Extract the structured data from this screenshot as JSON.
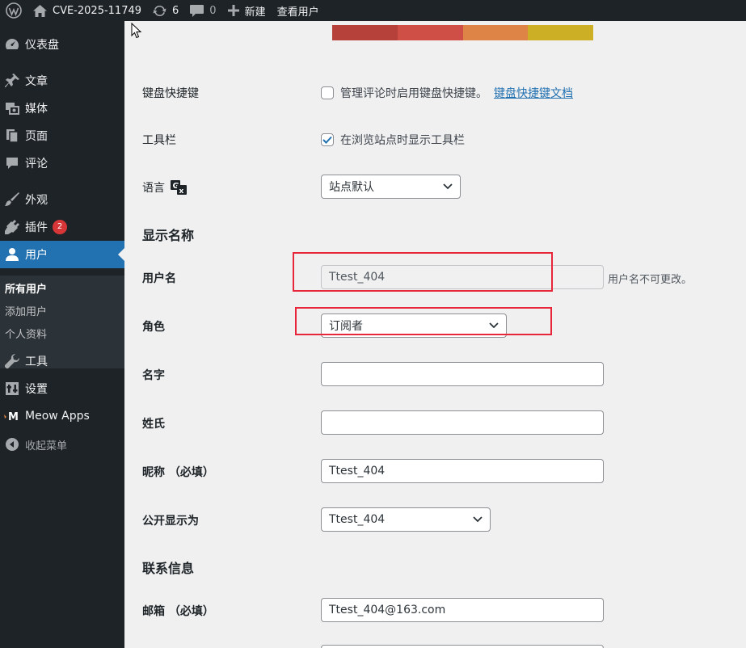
{
  "admin_bar": {
    "site_name": "CVE-2025-11749",
    "updates_count": "6",
    "comments_count": "0",
    "new_label": "新建",
    "view_user_label": "查看用户"
  },
  "sidebar": {
    "items": [
      {
        "label": "仪表盘",
        "icon": "dashboard-icon"
      },
      {
        "label": "文章",
        "icon": "pin-icon"
      },
      {
        "label": "媒体",
        "icon": "media-icon"
      },
      {
        "label": "页面",
        "icon": "page-icon"
      },
      {
        "label": "评论",
        "icon": "comment-icon"
      },
      {
        "label": "外观",
        "icon": "brush-icon"
      },
      {
        "label": "插件",
        "icon": "plugin-icon",
        "badge": "2"
      },
      {
        "label": "用户",
        "icon": "user-icon"
      },
      {
        "label": "工具",
        "icon": "wrench-icon"
      },
      {
        "label": "设置",
        "icon": "settings-icon"
      },
      {
        "label": "Meow Apps",
        "icon": "meow-icon"
      },
      {
        "label": "收起菜单",
        "icon": "collapse-icon"
      }
    ],
    "submenu": [
      "所有用户",
      "添加用户",
      "个人资料"
    ]
  },
  "colors": {
    "scheme_swatches": [
      "#b5413a",
      "#cf4f47",
      "#dd8446",
      "#ccaf25"
    ],
    "accent": "#2271b1",
    "highlight_box": "#e8263a"
  },
  "form": {
    "keyboard_shortcuts": {
      "label": "键盘快捷键",
      "checkbox_text": "管理评论时启用键盘快捷键。",
      "link_text": "键盘快捷键文档",
      "checked": false
    },
    "toolbar": {
      "label": "工具栏",
      "checkbox_text": "在浏览站点时显示工具栏",
      "checked": true
    },
    "language": {
      "label": "语言",
      "value": "站点默认"
    },
    "section_name": "显示名称",
    "username": {
      "label": "用户名",
      "value": "Ttest_404",
      "description": "用户名不可更改。"
    },
    "role": {
      "label": "角色",
      "value": "订阅者"
    },
    "first_name": {
      "label": "名字",
      "value": ""
    },
    "last_name": {
      "label": "姓氏",
      "value": ""
    },
    "nickname": {
      "label": "昵称 （必填）",
      "value": "Ttest_404"
    },
    "display_name": {
      "label": "公开显示为",
      "value": "Ttest_404"
    },
    "section_contact": "联系信息",
    "email": {
      "label": "邮箱 （必填）",
      "value": "Ttest_404@163.com"
    }
  }
}
